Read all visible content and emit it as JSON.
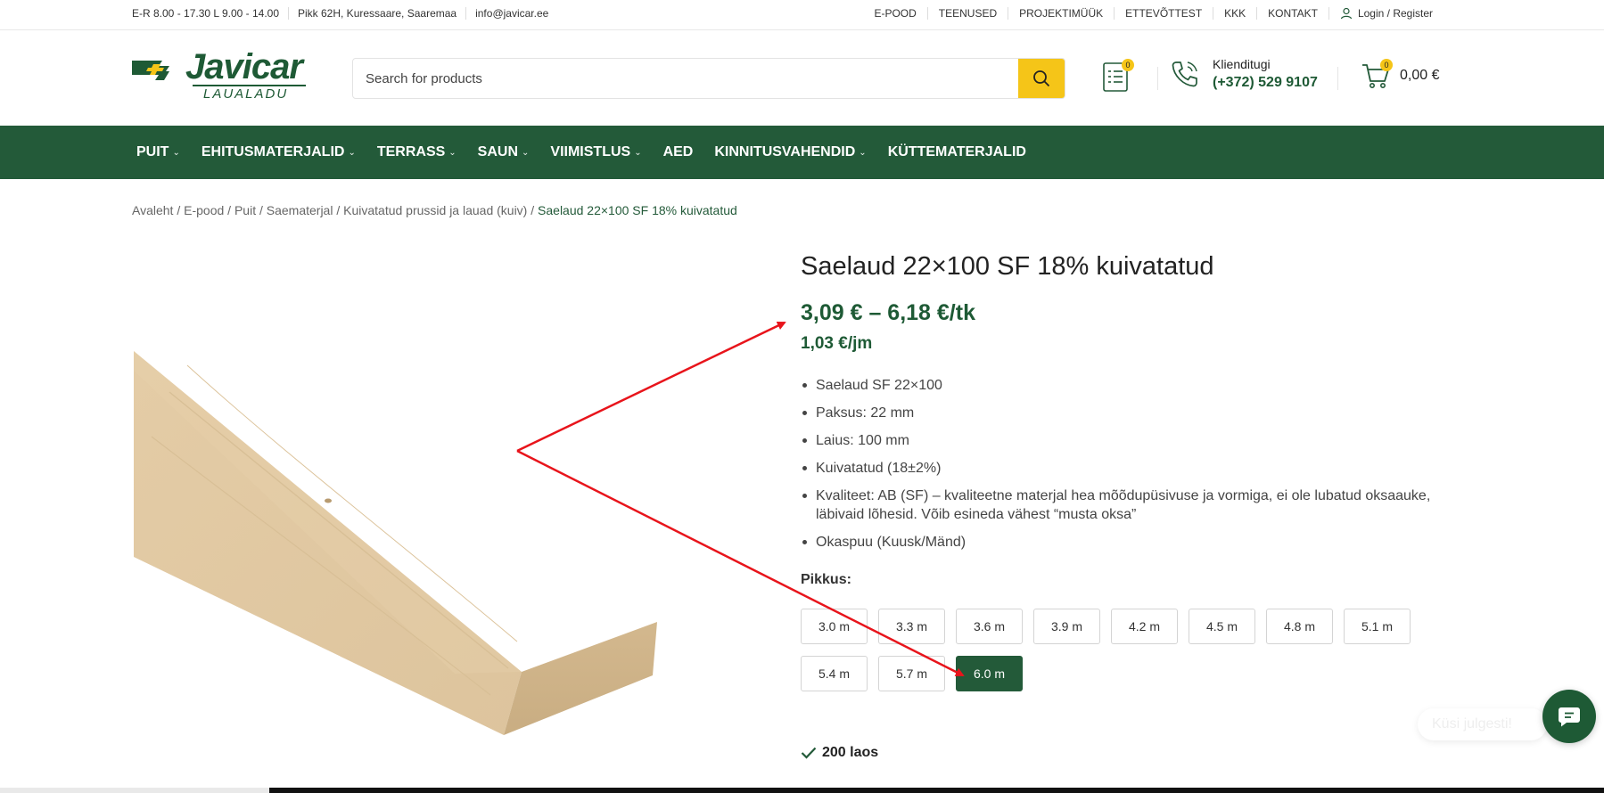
{
  "topbar": {
    "hours": "E-R 8.00 - 17.30 L 9.00 - 14.00",
    "address": "Pikk 62H, Kuressaare, Saaremaa",
    "email": "info@javicar.ee",
    "links": [
      "E-POOD",
      "TEENUSED",
      "PROJEKTIMÜÜK",
      "ETTEVÕTTEST",
      "KKK",
      "KONTAKT"
    ],
    "login": "Login / Register"
  },
  "header": {
    "logo_text": "Javicar",
    "logo_subtext": "LAUALADU",
    "search_placeholder": "Search for products",
    "wishlist_count": "0",
    "support_label": "Klienditugi",
    "support_phone": "(+372) 529 9107",
    "cart_count": "0",
    "cart_total": "0,00 €"
  },
  "nav": {
    "items": [
      {
        "label": "PUIT",
        "dropdown": true
      },
      {
        "label": "EHITUSMATERJALID",
        "dropdown": true
      },
      {
        "label": "TERRASS",
        "dropdown": true
      },
      {
        "label": "SAUN",
        "dropdown": true
      },
      {
        "label": "VIIMISTLUS",
        "dropdown": true
      },
      {
        "label": "AED",
        "dropdown": false
      },
      {
        "label": "KINNITUSVAHENDID",
        "dropdown": true
      },
      {
        "label": "KÜTTEMATERJALID",
        "dropdown": false
      }
    ]
  },
  "breadcrumb": {
    "items": [
      "Avaleht",
      "E-pood",
      "Puit",
      "Saematerjal",
      "Kuivatatud prussid ja lauad (kuiv)"
    ],
    "current": "Saelaud 22×100 SF 18% kuivatatud"
  },
  "product": {
    "title": "Saelaud 22×100 SF 18% kuivatatud",
    "price": "3,09 € – 6,18 €/tk",
    "unit_price": "1,03 €/jm",
    "features": [
      "Saelaud SF 22×100",
      "Paksus: 22 mm",
      "Laius: 100 mm",
      "Kuivatatud (18±2%)",
      "Kvaliteet: AB (SF) – kvaliteetne materjal hea mõõdupüsivuse ja vormiga, ei ole lubatud oksaauke, läbivaid lõhesid. Võib esineda vähest “musta oksa”",
      "Okaspuu (Kuusk/Mänd)"
    ],
    "attribute_label": "Pikkus",
    "sizes": [
      "3.0 m",
      "3.3 m",
      "3.6 m",
      "3.9 m",
      "4.2 m",
      "4.5 m",
      "4.8 m",
      "5.1 m",
      "5.4 m",
      "5.7 m",
      "6.0 m"
    ],
    "selected_size": "6.0 m",
    "stock": "200 laos"
  },
  "chat": {
    "label": "Küsi julgesti!"
  },
  "colors": {
    "brand_green": "#235a39",
    "accent_yellow": "#f5c518",
    "annotation_red": "#e8141b"
  }
}
